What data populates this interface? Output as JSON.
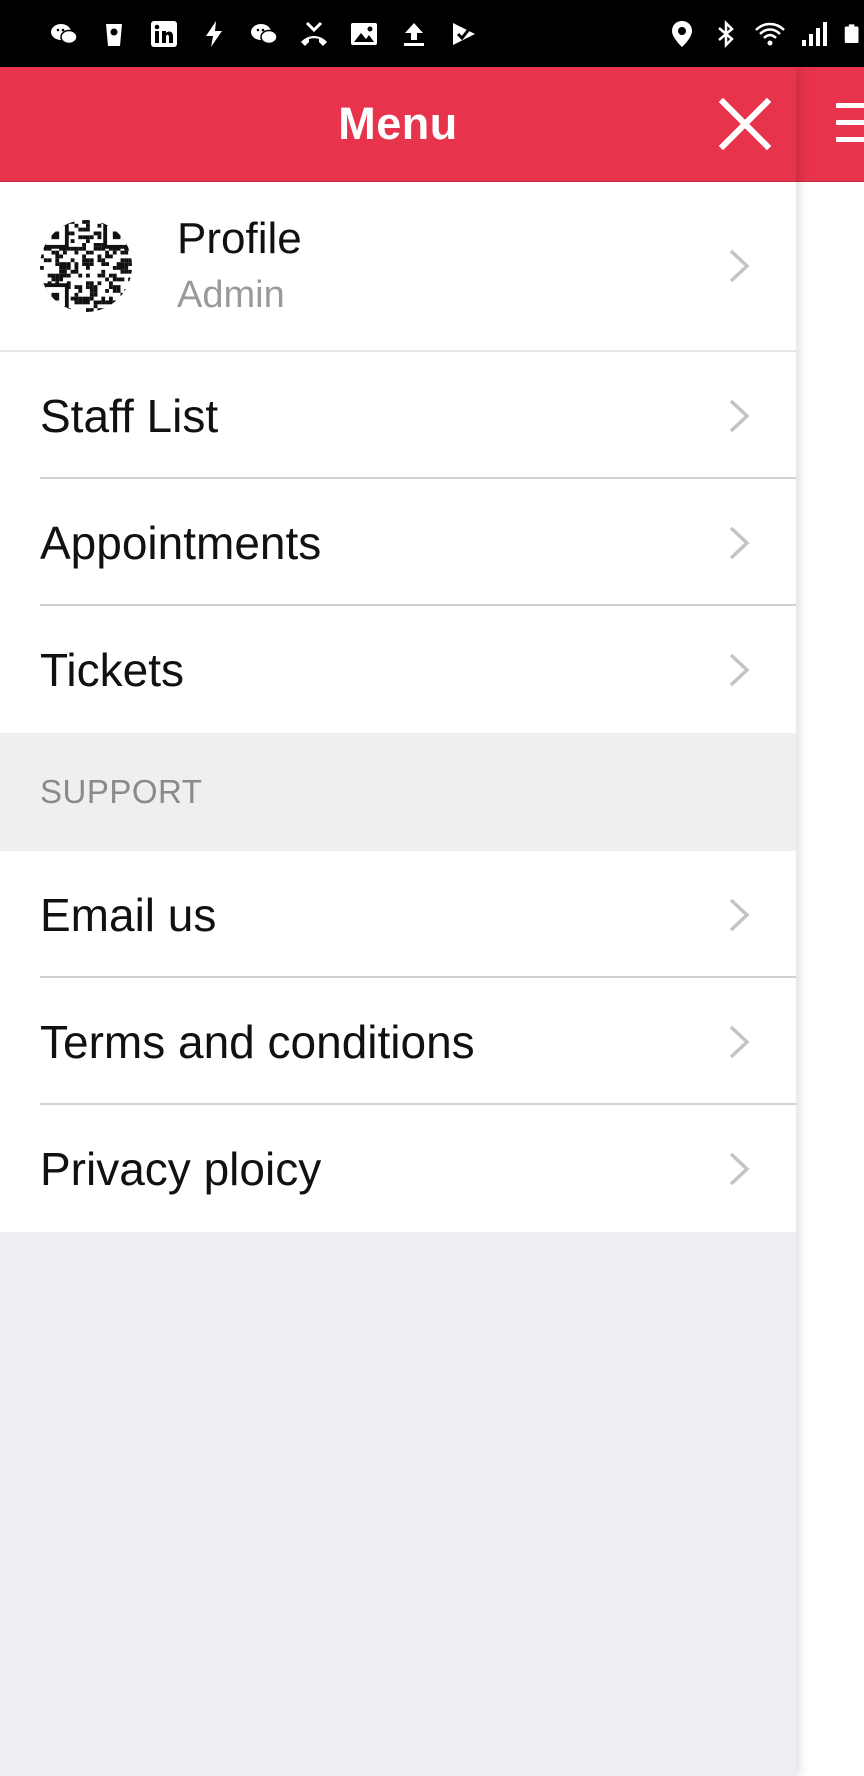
{
  "status_bar": {
    "left_icons": [
      "wechat-icon",
      "cup-icon",
      "linkedin-icon",
      "flash-icon",
      "wechat-icon",
      "missed-call-icon",
      "image-icon",
      "upload-icon",
      "check-icon"
    ],
    "right_icons": [
      "location-icon",
      "bluetooth-icon",
      "wifi-icon",
      "signal-icon",
      "battery-icon"
    ]
  },
  "drawer": {
    "title": "Menu",
    "close_icon": "close-icon",
    "accent_color": "#e8334d"
  },
  "profile": {
    "name": "Profile",
    "role": "Admin",
    "avatar_icon": "qr-code-avatar"
  },
  "main_items": [
    {
      "label": "Staff List"
    },
    {
      "label": "Appointments"
    },
    {
      "label": "Tickets"
    }
  ],
  "support_section": {
    "header": "SUPPORT",
    "items": [
      {
        "label": "Email us"
      },
      {
        "label": "Terms and conditions"
      },
      {
        "label": "Privacy ploicy"
      }
    ]
  },
  "background_page": {
    "menu_icon": "hamburger-menu-icon"
  }
}
